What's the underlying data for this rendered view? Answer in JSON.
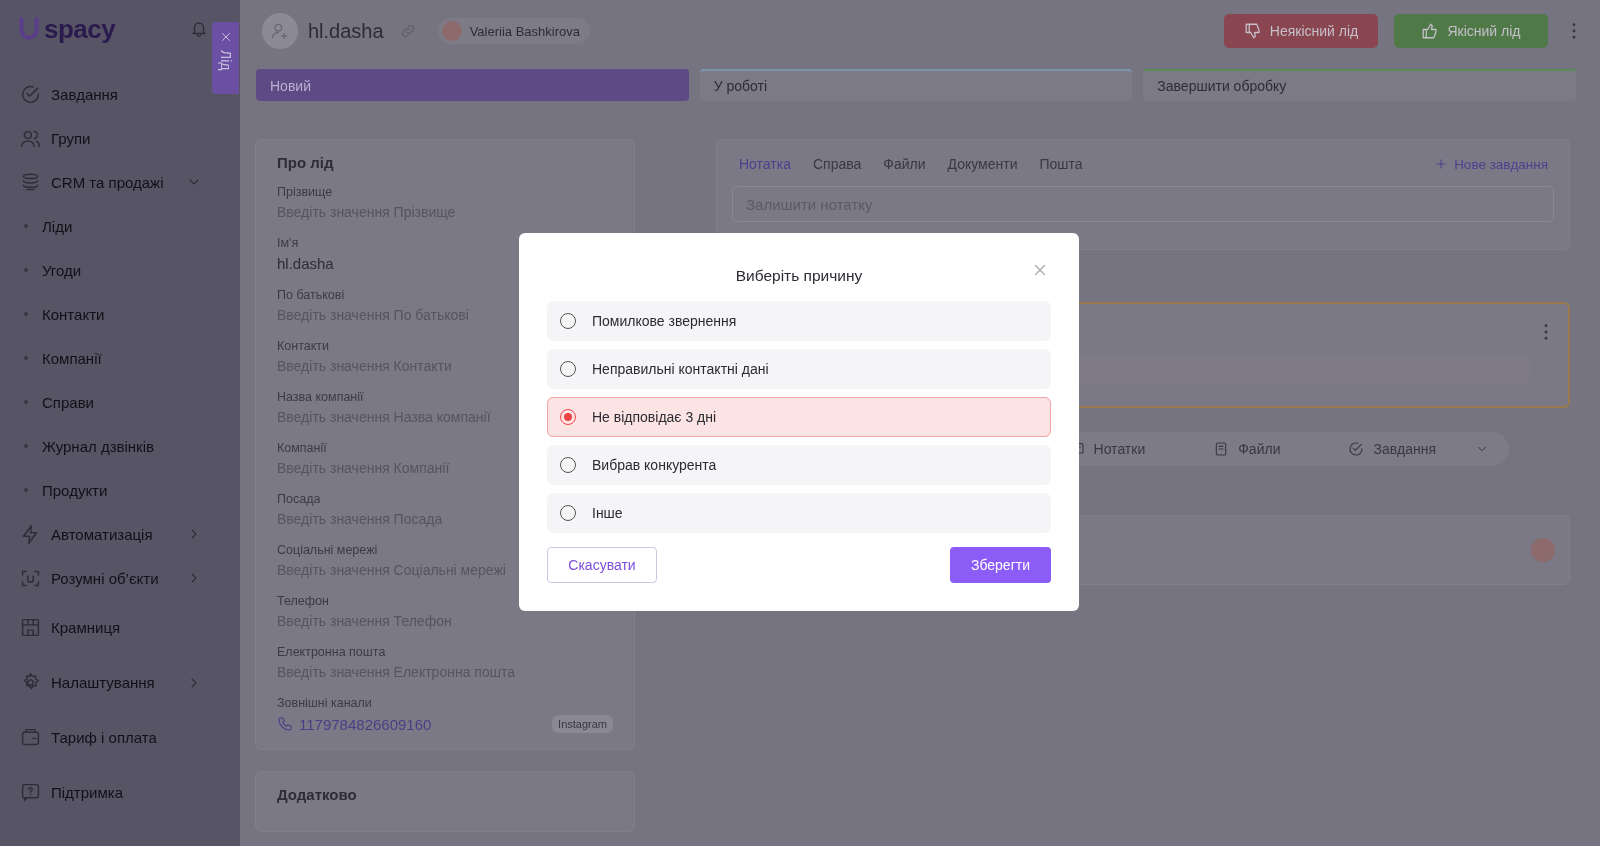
{
  "sidebar": {
    "logo": "spacy",
    "items": [
      {
        "label": "Завдання"
      },
      {
        "label": "Групи"
      },
      {
        "label": "CRM та продажі",
        "expanded": true,
        "children": [
          {
            "label": "Ліди"
          },
          {
            "label": "Угоди"
          },
          {
            "label": "Контакти"
          },
          {
            "label": "Компанії"
          },
          {
            "label": "Справи"
          },
          {
            "label": "Журнал дзвінків"
          },
          {
            "label": "Продукти"
          }
        ]
      },
      {
        "label": "Автоматизація",
        "expanded": false
      },
      {
        "label": "Розумні об’єкти",
        "expanded": false
      },
      {
        "label": "Крамниця"
      },
      {
        "label": "Налаштування",
        "expanded": false
      },
      {
        "label": "Тариф і оплата"
      },
      {
        "label": "Підтримка"
      }
    ]
  },
  "drawer_tab": {
    "label": "Лід"
  },
  "header": {
    "lead_name": "hl.dasha",
    "assignee": "Valeriia Bashkirova",
    "buttons": [
      {
        "label": "Неякісний лід",
        "kind": "bad"
      },
      {
        "label": "Якісний лід",
        "kind": "good"
      }
    ]
  },
  "stages": [
    {
      "label": "Новий",
      "selected": true,
      "color": "#5e4a85"
    },
    {
      "label": "У роботі",
      "selected": false,
      "color": "#7f93ad"
    },
    {
      "label": "Завершити обробку",
      "selected": false,
      "color": "#5b8a55"
    }
  ],
  "about": {
    "title": "Про лід",
    "fields": [
      {
        "label": "Прізвище",
        "placeholder": "Введіть значення Прізвище"
      },
      {
        "label": "Ім'я",
        "value": "hl.dasha"
      },
      {
        "label": "По батькові",
        "placeholder": "Введіть значення По батькові"
      },
      {
        "label": "Контакти",
        "placeholder": "Введіть значення Контакти"
      },
      {
        "label": "Назва компанії",
        "placeholder": "Введіть значення Назва компанії"
      },
      {
        "label": "Компанії",
        "placeholder": "Введіть значення Компанії"
      },
      {
        "label": "Посада",
        "placeholder": "Введіть значення Посада"
      },
      {
        "label": "Соціальні мережі",
        "placeholder": "Введіть значення Соціальні мережі"
      },
      {
        "label": "Телефон",
        "placeholder": "Введіть значення Телефон"
      },
      {
        "label": "Електронна пошта",
        "placeholder": "Введіть значення Електронна пошта"
      }
    ],
    "channels_label": "Зовнішні канали",
    "phone": "1179784826609160",
    "channel_badge": "Instagram"
  },
  "additional": {
    "title": "Додатково"
  },
  "activity": {
    "tabs": [
      {
        "label": "Нотатка",
        "selected": true
      },
      {
        "label": "Справа",
        "selected": false
      },
      {
        "label": "Файли",
        "selected": false
      },
      {
        "label": "Документи",
        "selected": false
      },
      {
        "label": "Пошта",
        "selected": false
      }
    ],
    "new_task": "Нове завдання",
    "note_placeholder": "Залишити нотатку"
  },
  "filters": [
    {
      "label": "Нотатки",
      "kind": "notes"
    },
    {
      "label": "Файли",
      "kind": "files"
    },
    {
      "label": "Завдання",
      "kind": "tasks"
    }
  ],
  "modal": {
    "title": "Виберіть причину",
    "options": [
      {
        "label": "Помилкове звернення",
        "selected": false
      },
      {
        "label": "Неправильні контактні дані",
        "selected": false
      },
      {
        "label": "Не відповідає 3 дні",
        "selected": true
      },
      {
        "label": "Вибрав конкурента",
        "selected": false
      },
      {
        "label": "Інше",
        "selected": false
      }
    ],
    "cancel": "Скасувати",
    "save": "Зберегти"
  }
}
